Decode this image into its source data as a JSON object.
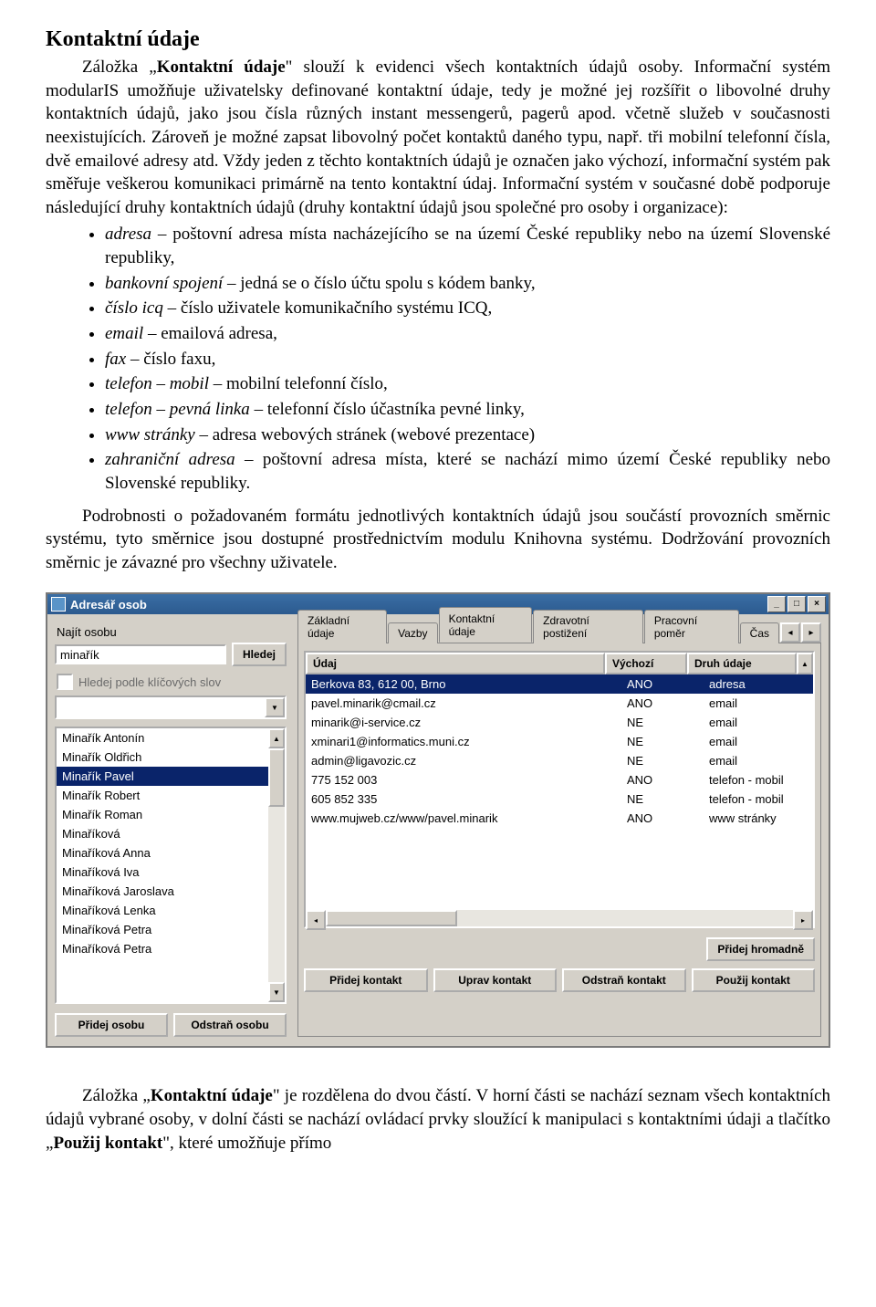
{
  "doc": {
    "heading": "Kontaktní údaje",
    "p1a": "Záložka „",
    "p1b": "Kontaktní údaje",
    "p1c": "\" slouží k evidenci všech kontaktních údajů osoby. Informační systém modularIS umožňuje uživatelsky definované kontaktní údaje, tedy je možné jej rozšířit o libovolné druhy kontaktních údajů, jako jsou čísla různých instant messengerů, pagerů apod. včetně služeb v současnosti neexistujících. Zároveň je možné zapsat libovolný počet kontaktů daného typu, např. tři mobilní telefonní čísla, dvě emailové adresy atd. Vždy jeden z těchto kontaktních údajů je označen jako výchozí, informační systém pak směřuje veškerou komunikaci primárně na tento kontaktní údaj. Informační systém v současné době podporuje následující druhy kontaktních údajů (druhy kontaktní údajů jsou společné pro osoby i organizace):",
    "bullets": [
      {
        "em": "adresa",
        "text": " – poštovní adresa místa nacházejícího se na území České republiky nebo na území Slovenské republiky,"
      },
      {
        "em": "bankovní spojení",
        "text": " – jedná se o číslo účtu spolu s kódem banky,"
      },
      {
        "em": "číslo icq",
        "text": " – číslo uživatele komunikačního systému ICQ,"
      },
      {
        "em": "email",
        "text": " – emailová adresa,"
      },
      {
        "em": "fax",
        "text": " – číslo faxu,"
      },
      {
        "em": "telefon – mobil",
        "text": " – mobilní telefonní číslo,"
      },
      {
        "em": "telefon – pevná linka",
        "text": " – telefonní číslo účastníka pevné linky,"
      },
      {
        "em": "www stránky",
        "text": " – adresa webových stránek (webové prezentace)"
      },
      {
        "em": "zahraniční adresa",
        "text": " – poštovní adresa místa, které se nachází mimo území České republiky nebo Slovenské republiky."
      }
    ],
    "p2": "Podrobnosti o požadovaném formátu jednotlivých kontaktních údajů jsou součástí provozních směrnic systému, tyto směrnice jsou dostupné prostřednictvím modulu Knihovna systému. Dodržování provozních směrnic je závazné pro všechny uživatele.",
    "p3a": "Záložka „",
    "p3b": "Kontaktní údaje",
    "p3c": "\" je rozdělena do dvou částí. V horní části se nachází seznam všech kontaktních údajů vybrané osoby, v dolní části se nachází ovládací prvky sloužící k manipulaci s kontaktními údaji a tlačítko „",
    "p3d": "Použij kontakt",
    "p3e": "\", které umožňuje přímo"
  },
  "app": {
    "title": "Adresář osob",
    "left": {
      "search_label": "Najít osobu",
      "search_value": "minařík",
      "search_btn": "Hledej",
      "keyword_chk": "Hledej podle klíčových slov",
      "persons": [
        "Minařík Antonín",
        "Minařík Oldřich",
        "Minařík Pavel",
        "Minařík Robert",
        "Minařík Roman",
        "Minaříková",
        "Minaříková Anna",
        "Minaříková Iva",
        "Minaříková Jaroslava",
        "Minaříková Lenka",
        "Minaříková Petra",
        "Minaříková Petra"
      ],
      "selected_index": 2,
      "btn_add": "Přidej osobu",
      "btn_del": "Odstraň osobu"
    },
    "right": {
      "tabs": [
        "Základní údaje",
        "Vazby",
        "Kontaktní údaje",
        "Zdravotní postižení",
        "Pracovní poměr",
        "Čas"
      ],
      "active_tab": 2,
      "header": {
        "c1": "Údaj",
        "c2": "Výchozí",
        "c3": "Druh údaje"
      },
      "rows": [
        {
          "c1": "Berkova 83, 612 00, Brno",
          "c2": "ANO",
          "c3": "adresa",
          "sel": true
        },
        {
          "c1": "pavel.minarik@cmail.cz",
          "c2": "ANO",
          "c3": "email"
        },
        {
          "c1": "minarik@i-service.cz",
          "c2": "NE",
          "c3": "email"
        },
        {
          "c1": "xminari1@informatics.muni.cz",
          "c2": "NE",
          "c3": "email"
        },
        {
          "c1": "admin@ligavozic.cz",
          "c2": "NE",
          "c3": "email"
        },
        {
          "c1": "775 152 003",
          "c2": "ANO",
          "c3": "telefon - mobil"
        },
        {
          "c1": "605 852 335",
          "c2": "NE",
          "c3": "telefon - mobil"
        },
        {
          "c1": "www.mujweb.cz/www/pavel.minarik",
          "c2": "ANO",
          "c3": "www stránky"
        }
      ],
      "btn_bulk": "Přidej hromadně",
      "btn_add": "Přidej kontakt",
      "btn_edit": "Uprav kontakt",
      "btn_del": "Odstraň kontakt",
      "btn_use": "Použij kontakt"
    }
  }
}
